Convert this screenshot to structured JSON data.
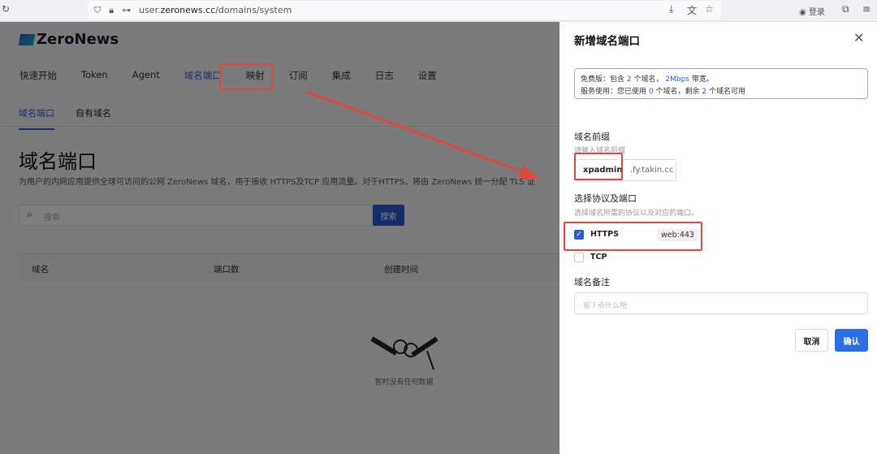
{
  "browser": {
    "url_host": "user.",
    "url_domain": "zeronews.cc",
    "url_path": "/domains/system",
    "login": "登录"
  },
  "page": {
    "logo": "ZeroNews",
    "nav": [
      "快速开始",
      "Token",
      "Agent",
      "域名端口",
      "映射",
      "订阅",
      "集成",
      "日志",
      "设置"
    ],
    "subtabs": [
      "域名端口",
      "自有域名"
    ],
    "title": "域名端口",
    "description": "为用户的内网应用提供全球可访问的公网 ZeroNews 域名，用于接收 HTTPS及TCP 应用流量。对于HTTPS，将由 ZeroNews 统一分配 TLS 证",
    "search_placeholder": "搜索",
    "search_button": "搜索",
    "columns": [
      "域名",
      "端口数",
      "创建时间"
    ],
    "empty_text": "暂时没有任何数据"
  },
  "drawer": {
    "title": "新增域名端口",
    "info": {
      "l1a": "免费版：包含",
      "l1n": "2",
      "l1b": "个域名，",
      "l1bw": "2Mbps",
      "l1c": "带宽。",
      "l2a": "服务使用：您已使用",
      "l2n": "0",
      "l2b": "个域名，剩余",
      "l2r": "2",
      "l2c": "个域名可用"
    },
    "prefix_label": "域名前缀",
    "prefix_hint": "请输入域名前缀",
    "prefix_value": "xpadmin",
    "prefix_suffix": ".fy.takin.cc",
    "protocol_label": "选择协议及端口",
    "protocol_hint": "选择域名所需的协议以及对应的端口。",
    "protocols": [
      {
        "name": "HTTPS",
        "checked": true,
        "port": "web:443"
      },
      {
        "name": "TCP",
        "checked": false
      }
    ],
    "remark_label": "域名备注",
    "remark_placeholder": "留下点什么吧",
    "cancel": "取消",
    "confirm": "确认"
  },
  "colors": {
    "accent": "#2a5bd7",
    "annotation": "#e0483e"
  }
}
